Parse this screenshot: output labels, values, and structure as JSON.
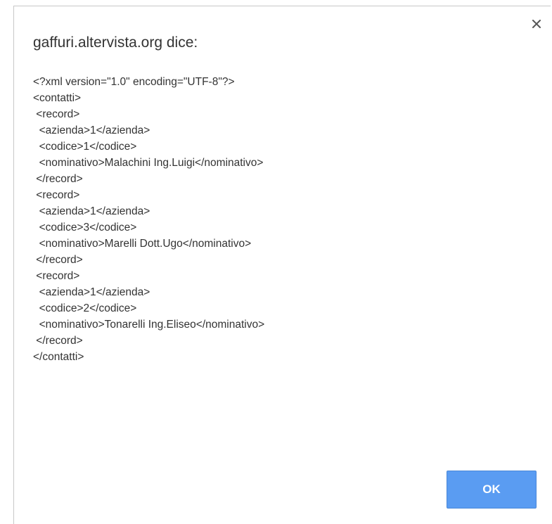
{
  "dialog": {
    "title": "gaffuri.altervista.org dice:",
    "close_icon": "close-icon",
    "message_lines": [
      "<?xml version=\"1.0\" encoding=\"UTF-8\"?>",
      "<contatti>",
      " <record>",
      "  <azienda>1</azienda>",
      "  <codice>1</codice>",
      "  <nominativo>Malachini Ing.Luigi</nominativo>",
      " </record>",
      " <record>",
      "  <azienda>1</azienda>",
      "  <codice>3</codice>",
      "  <nominativo>Marelli Dott.Ugo</nominativo>",
      " </record>",
      " <record>",
      "  <azienda>1</azienda>",
      "  <codice>2</codice>",
      "  <nominativo>Tonarelli Ing.Eliseo</nominativo>",
      " </record>",
      "</contatti>"
    ],
    "ok_label": "OK",
    "accent_color": "#5a9cf2"
  }
}
